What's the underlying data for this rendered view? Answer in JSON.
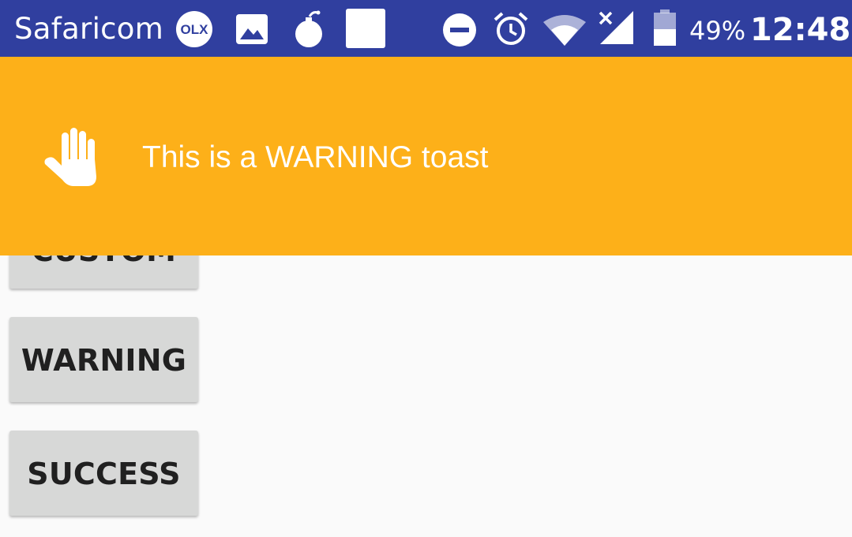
{
  "status_bar": {
    "carrier": "Safaricom",
    "notification_icons": [
      "olx-icon",
      "image-icon",
      "bomb-icon",
      "square-icon"
    ],
    "system_icons": [
      "do-not-disturb-icon",
      "alarm-icon",
      "wifi-icon",
      "no-signal-icon",
      "battery-icon"
    ],
    "battery_percent": "49%",
    "time": "12:48",
    "background_color": "#303f9f"
  },
  "toast": {
    "message": "This is a WARNING toast",
    "icon": "hand-stop-icon",
    "background_color": "#fdb019",
    "text_color": "#ffffff"
  },
  "buttons": {
    "custom_label": "CUSTOM",
    "warning_label": "WARNING",
    "success_label": "SUCCESS"
  },
  "olx_badge_text": "OLX"
}
